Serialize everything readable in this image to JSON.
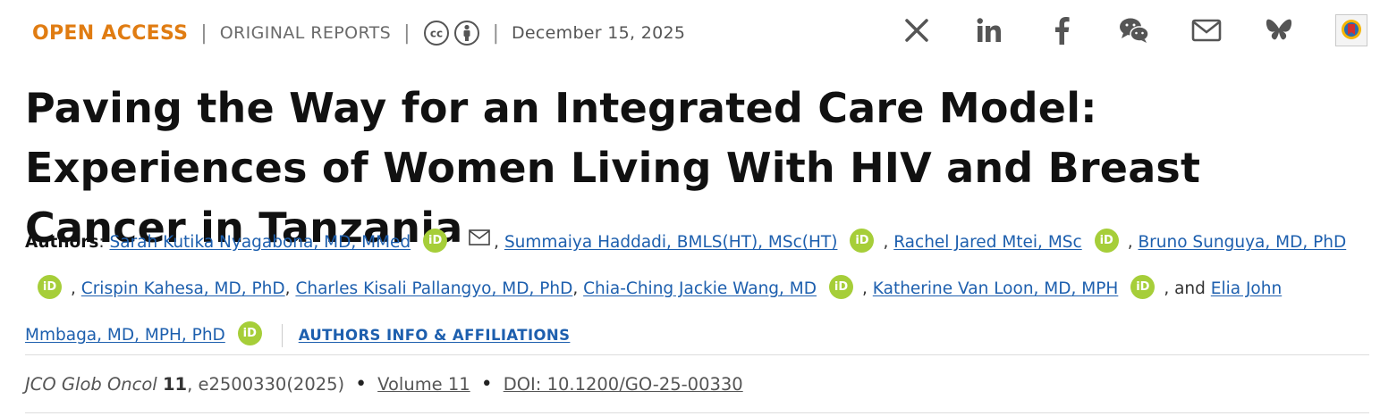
{
  "header": {
    "access": "OPEN ACCESS",
    "separator": "|",
    "article_type": "ORIGINAL REPORTS",
    "date": "December 15, 2025",
    "license_icons": [
      "cc-icon",
      "by-attribution-icon"
    ]
  },
  "social": [
    "x-icon",
    "linkedin-icon",
    "facebook-icon",
    "wechat-icon",
    "email-icon",
    "bluesky-icon",
    "mendeley-icon"
  ],
  "title": "Paving the Way for an Integrated Care Model: Experiences of Women Living With HIV and Breast Cancer in Tanzania",
  "authors": {
    "label": "Authors",
    "colon": ":",
    "comma": ",",
    "and": ", and",
    "list": [
      "Sarah Kutika Nyagabona, MD, MMed",
      "Summaiya Haddadi, BMLS(HT), MSc(HT)",
      "Rachel Jared Mtei, MSc",
      "Bruno Sunguya, MD, PhD",
      "Crispin Kahesa, MD, PhD",
      "Charles Kisali Pallangyo, MD, PhD",
      "Chia-Ching Jackie Wang, MD",
      "Katherine Van Loon, MD, MPH",
      "Elia John Mmbaga, MD, MPH, PhD"
    ],
    "orcid_label": "iD",
    "affiliations_link": "AUTHORS INFO & AFFILIATIONS"
  },
  "citation": {
    "journal": "JCO Glob Oncol",
    "volume_number": "11",
    "article_id": "e2500330(2025)",
    "bullet": "•",
    "volume_link": "Volume 11",
    "doi": "DOI: 10.1200/GO-25-00330"
  },
  "colors": {
    "open_access": "#e07c12",
    "link": "#1d5fae",
    "orcid": "#a6ce39"
  }
}
